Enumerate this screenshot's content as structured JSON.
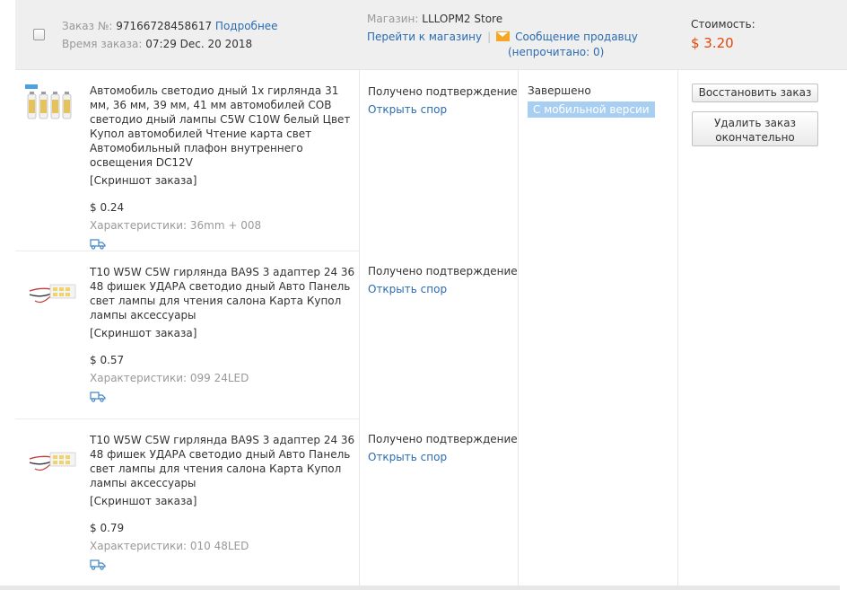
{
  "order": {
    "number_label": "Заказ №:",
    "number": "97166728458617",
    "details_link": "Подробнее",
    "time_label": "Время заказа:",
    "time": "07:29 Dec. 20 2018",
    "store_label": "Магазин:",
    "store_name": "LLLOPM2 Store",
    "go_to_store": "Перейти к магазину",
    "message_seller": "Сообщение продавцу",
    "unread": "(непрочитано: 0)",
    "cost_label": "Стоимость:",
    "cost": "$ 3.20",
    "state": "Завершено",
    "mobile_badge": "С мобильной версии",
    "restore_button": "Восстановить заказ",
    "delete_button_line1": "Удалить заказ",
    "delete_button_line2": "окончательно"
  },
  "items": [
    {
      "title": "Автомобиль светодио дный 1x гирлянда 31 мм, 36 мм, 39 мм, 41 мм автомобилей COB светодио дный лампы C5W C10W белый Цвет Купол автомобилей Чтение карта свет Автомобильный плафон внутреннего освещения DC12V",
      "screenshot": "[Скриншот заказа]",
      "price": "$ 0.24",
      "spec": "Характеристики: 36mm + 008",
      "status": "Получено подтверждение",
      "dispute": "Открыть спор"
    },
    {
      "title": "T10 W5W C5W гирлянда BA9S 3 адаптер 24 36 48 фишек УДАРА светодио дный Авто Панель свет лампы для чтения салона Карта Купол лампы аксессуары",
      "screenshot": "[Скриншот заказа]",
      "price": "$ 0.57",
      "spec": "Характеристики: 099 24LED",
      "status": "Получено подтверждение",
      "dispute": "Открыть спор"
    },
    {
      "title": "T10 W5W C5W гирлянда BA9S 3 адаптер 24 36 48 фишек УДАРА светодио дный Авто Панель свет лампы для чтения салона Карта Купол лампы аксессуары",
      "screenshot": "[Скриншот заказа]",
      "price": "$ 0.79",
      "spec": "Характеристики: 010 48LED",
      "status": "Получено подтверждение",
      "dispute": "Открыть спор"
    }
  ],
  "colors": {
    "link": "#2a6cb0",
    "price": "#e0480b",
    "badge": "#a8cff2",
    "header_bg": "#efefef"
  },
  "icons": {
    "mail": "envelope-icon",
    "shipping": "truck-icon"
  }
}
